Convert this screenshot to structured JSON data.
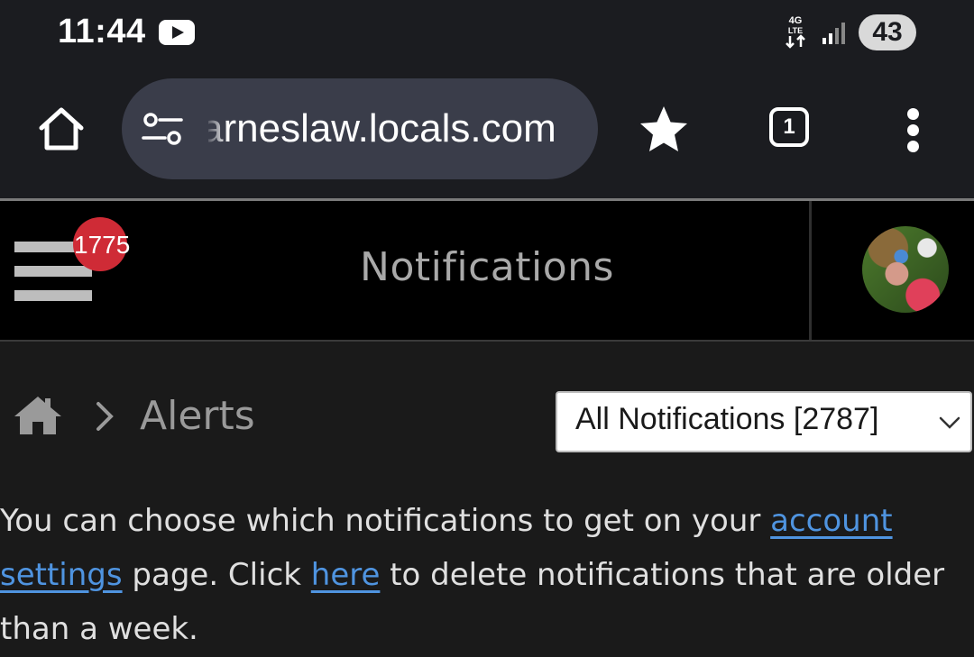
{
  "status_bar": {
    "time": "11:44",
    "network_type": "4G LTE",
    "battery": "43",
    "icons": [
      "youtube-icon",
      "network-4g-icon",
      "signal-icon"
    ]
  },
  "browser": {
    "url": "arneslaw.locals.com",
    "tab_count": "1",
    "icons": [
      "home-icon",
      "site-settings-icon",
      "bookmark-star-icon",
      "tab-switcher-icon",
      "more-menu-icon"
    ]
  },
  "header": {
    "notification_count": "1775",
    "title": "Notifications",
    "icons": [
      "hamburger-menu-icon",
      "avatar"
    ]
  },
  "breadcrumb": {
    "current": "Alerts",
    "icons": [
      "home-icon",
      "chevron-right-icon"
    ]
  },
  "filter": {
    "selected": "All Notifications [2787]",
    "icon": "chevron-down-icon"
  },
  "info": {
    "text_1": "You can choose which notifications to get on your ",
    "link_1": "account settings",
    "text_2": " page. Click ",
    "link_2": "here",
    "text_3": " to delete notifications that are older than a week."
  },
  "colors": {
    "badge": "#cf2b36",
    "link": "#4f94e0",
    "background": "#1a1a1a",
    "header_background": "#000000"
  }
}
